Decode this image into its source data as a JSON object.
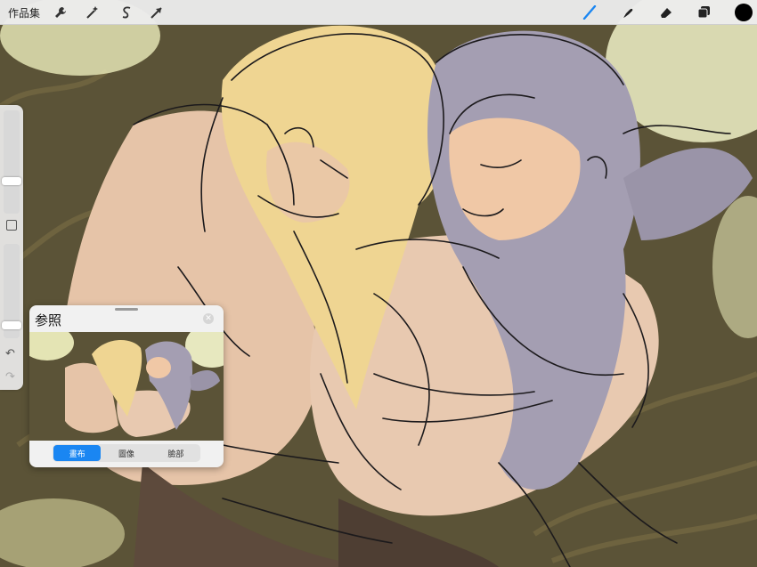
{
  "toolbar": {
    "gallery_label": "作品集",
    "left_tools": [
      {
        "name": "actions",
        "icon": "wrench-icon"
      },
      {
        "name": "adjustments",
        "icon": "magic-wand-icon"
      },
      {
        "name": "selection",
        "icon": "selection-s-icon"
      },
      {
        "name": "transform",
        "icon": "arrow-cursor-icon"
      }
    ],
    "right_tools": [
      {
        "name": "brush",
        "icon": "brush-icon",
        "active": true,
        "color": "#1a86f2"
      },
      {
        "name": "smudge",
        "icon": "smudge-icon"
      },
      {
        "name": "eraser",
        "icon": "eraser-icon"
      },
      {
        "name": "layers",
        "icon": "layers-icon"
      }
    ],
    "current_color": "#000000"
  },
  "sidebar": {
    "brush_size": 0.3,
    "opacity": 0.1,
    "modify_icon": "square-icon",
    "undo_icon": "undo-icon",
    "redo_icon": "redo-icon"
  },
  "reference_panel": {
    "title": "参照",
    "close_icon": "close-icon",
    "tabs": [
      {
        "label": "畫布",
        "active": true
      },
      {
        "label": "圖像",
        "active": false
      },
      {
        "label": "臉部",
        "active": false
      }
    ]
  },
  "canvas": {
    "artwork": "sketch of two sleeping figures on grass",
    "palette": {
      "grass": "#5b5337",
      "light_bg": "#e4e4b4",
      "skin": "#e2c2a4",
      "blonde_hair": "#efd592",
      "silver_hair": "#a49eb2",
      "line": "#1c1a1c"
    }
  }
}
